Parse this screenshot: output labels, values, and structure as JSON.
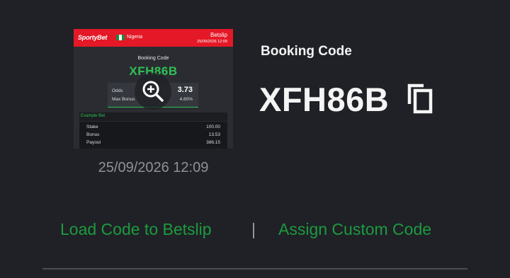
{
  "thumbnail": {
    "brand": "SportyBet",
    "country": "Nigeria",
    "betslip_title": "Betslip",
    "betslip_datetime": "25/09/2026 12:09",
    "code_label": "Booking Code",
    "code": "XFH86B",
    "odds_label": "Odds",
    "odds_value": "3.73",
    "max_bonus_label": "Max Bonus",
    "max_bonus_value": "4.80%",
    "example_label": "Example Bet",
    "stake_label": "Stake",
    "stake_value": "100.00",
    "bonus_label": "Bonus",
    "bonus_value": "13.53",
    "payout_label": "Payout",
    "payout_value": "386.15"
  },
  "timestamp": "25/09/2026 12:09",
  "booking": {
    "label": "Booking Code",
    "code": "XFH86B"
  },
  "actions": {
    "load": "Load Code to Betslip",
    "separator": "|",
    "assign": "Assign Custom Code"
  },
  "colors": {
    "background": "#1f2126",
    "accent_green": "#1d9a3f",
    "brand_red": "#e41827"
  },
  "icons": [
    "zoom-in-icon",
    "copy-icon"
  ]
}
